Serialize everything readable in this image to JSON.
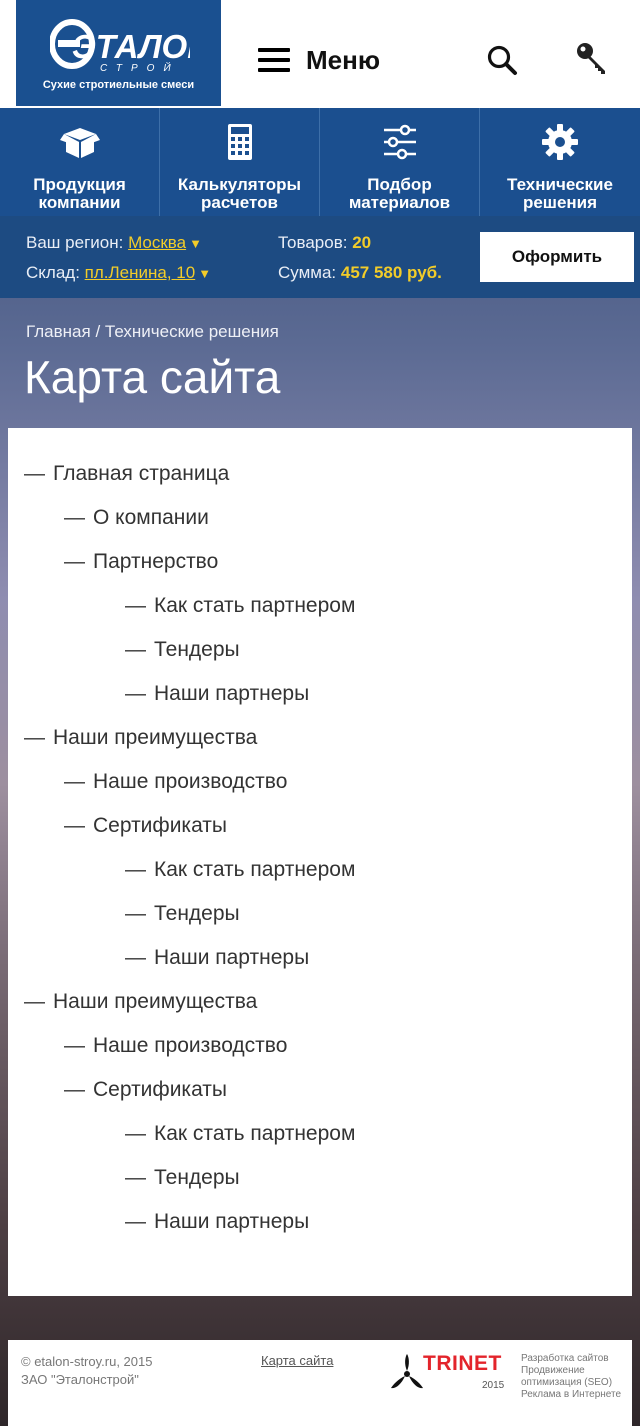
{
  "header": {
    "brand": "ЭТАЛОН",
    "brand_sub": "СТРОЙ",
    "tagline": "Сухие стротиельные смеси",
    "menu_label": "Меню",
    "icons": {
      "menu": "hamburger-icon",
      "search": "search-icon",
      "login": "key-icon"
    }
  },
  "categories": [
    {
      "label_line1": "Продукция",
      "label_line2": "компании",
      "icon": "box-icon"
    },
    {
      "label_line1": "Калькуляторы",
      "label_line2": "расчетов",
      "icon": "calculator-icon"
    },
    {
      "label_line1": "Подбор",
      "label_line2": "материалов",
      "icon": "sliders-icon"
    },
    {
      "label_line1": "Технические",
      "label_line2": "решения",
      "icon": "gear-icon"
    }
  ],
  "info": {
    "region_label": "Ваш регион:",
    "region_value": "Москва",
    "stock_label": "Склад:",
    "stock_value": "пл.Ленина, 10",
    "goods_label": "Товаров:",
    "goods_value": "20",
    "sum_label": "Сумма:",
    "sum_value": "457 580 руб.",
    "order_label": "Оформить"
  },
  "breadcrumb": {
    "home": "Главная",
    "separator": " / ",
    "current": "Технические решения"
  },
  "page_title": "Карта сайта",
  "sitemap": [
    {
      "dash": "—",
      "text": "Главная страница",
      "level": 0
    },
    {
      "dash": "—",
      "text": "О компании",
      "level": 1
    },
    {
      "dash": "—",
      "text": "Партнерство",
      "level": 1
    },
    {
      "dash": "—",
      "text": "Как стать партнером",
      "level": 2
    },
    {
      "dash": "—",
      "text": "Тендеры",
      "level": 2
    },
    {
      "dash": "—",
      "text": "Наши партнеры",
      "level": 2
    },
    {
      "dash": "—",
      "text": "Наши преимущества",
      "level": 0
    },
    {
      "dash": "—",
      "text": "Наше производство",
      "level": 1
    },
    {
      "dash": "—",
      "text": "Сертификаты",
      "level": 1
    },
    {
      "dash": "—",
      "text": "Как стать партнером",
      "level": 2
    },
    {
      "dash": "—",
      "text": "Тендеры",
      "level": 2
    },
    {
      "dash": "—",
      "text": "Наши партнеры",
      "level": 2
    },
    {
      "dash": "—",
      "text": "Наши преимущества",
      "level": 0
    },
    {
      "dash": "—",
      "text": "Наше производство",
      "level": 1
    },
    {
      "dash": "—",
      "text": "Сертификаты",
      "level": 1
    },
    {
      "dash": "—",
      "text": "Как стать партнером",
      "level": 2
    },
    {
      "dash": "—",
      "text": "Тендеры",
      "level": 2
    },
    {
      "dash": "—",
      "text": "Наши партнеры",
      "level": 2
    }
  ],
  "footer": {
    "copyright_line1": "© etalon-stroy.ru, 2015",
    "copyright_line2": "ЗАО \"Эталонстрой\"",
    "sitemap_link": "Карта сайта",
    "dev_brand": "TRINET",
    "dev_year": "2015",
    "dev_services": [
      "Разработка сайтов",
      "Продвижение",
      "оптимизация (SEO)",
      "Реклама в Интернете"
    ]
  },
  "colors": {
    "brand_blue": "#1b4f8f",
    "accent_yellow": "#f2cc29",
    "trinet_red": "#e3242b"
  }
}
